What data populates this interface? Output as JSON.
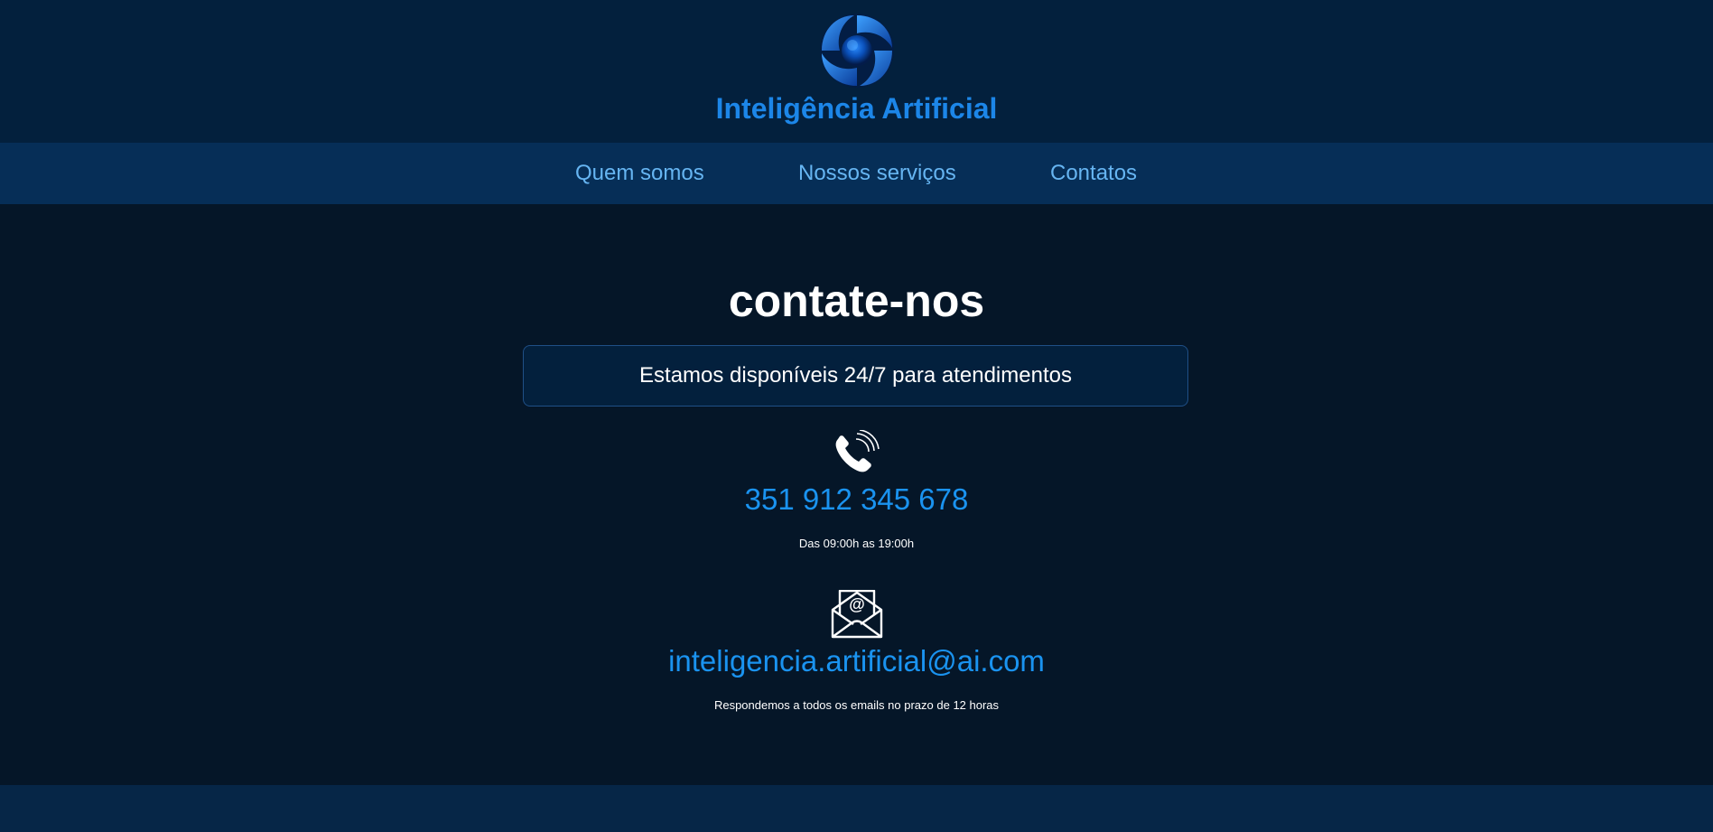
{
  "header": {
    "logo_icon": "swirl-orb-logo",
    "title": "Inteligência Artificial"
  },
  "nav": {
    "items": [
      {
        "label": "Quem somos"
      },
      {
        "label": "Nossos serviços"
      },
      {
        "label": "Contatos"
      }
    ]
  },
  "main": {
    "title": "contate-nos",
    "availability": "Estamos disponíveis 24/7 para atendimentos",
    "phone": {
      "icon": "phone-ringing-icon",
      "number": "351 912 345 678",
      "hours": "Das 09:00h as 19:00h"
    },
    "email": {
      "icon": "email-open-icon",
      "address": "inteligencia.artificial@ai.com",
      "note": "Respondemos a todos os emails no prazo de 12 horas"
    }
  },
  "colors": {
    "header_bg": "#03203d",
    "nav_bg": "#062e57",
    "page_bg": "#051628",
    "accent": "#1a93f0",
    "nav_link": "#66b5f2",
    "footer_bg": "#062647"
  }
}
